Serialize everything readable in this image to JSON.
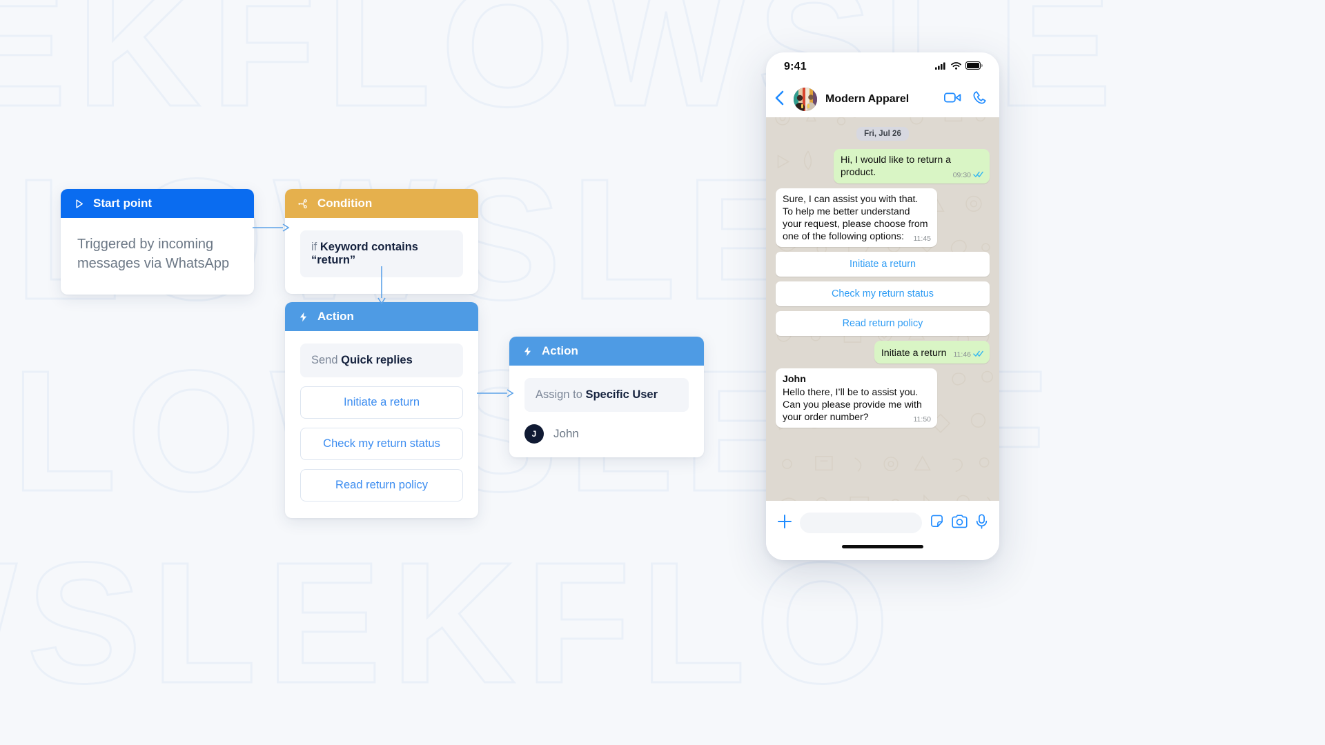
{
  "watermark": {
    "lines": [
      "EKFLOWSLE",
      "KFLOWSLEK",
      "FLOWSLEKF",
      "OWSLEKFLO"
    ]
  },
  "flow": {
    "nodes": [
      {
        "id": "start",
        "header": "Start point",
        "icon": "play-icon",
        "description": "Triggered by incoming messages via WhatsApp"
      },
      {
        "id": "condition",
        "header": "Condition",
        "icon": "branch-icon",
        "field_prefix": "if",
        "field_value": "Keyword contains “return”"
      },
      {
        "id": "action-quick-replies",
        "header": "Action",
        "icon": "bolt-icon",
        "field_prefix": "Send",
        "field_value": "Quick replies",
        "quick_replies": [
          "Initiate a return",
          "Check my return status",
          "Read return policy"
        ]
      },
      {
        "id": "action-assign",
        "header": "Action",
        "icon": "bolt-icon",
        "field_prefix": "Assign to",
        "field_value": "Specific User",
        "assignee": {
          "initial": "J",
          "name": "John"
        }
      }
    ],
    "colors": {
      "start_header": "#0a6cf0",
      "condition_header": "#e5b04d",
      "action_header": "#4e9be4",
      "connector": "#5ca2e8",
      "link_text": "#3b8cf0"
    }
  },
  "phone": {
    "status_bar": {
      "time": "9:41",
      "icons": [
        "cellular-signal-icon",
        "wifi-icon",
        "battery-icon"
      ]
    },
    "chat_header": {
      "back_icon": "back-chevron-icon",
      "avatar": "contact-avatar",
      "title": "Modern Apparel",
      "actions": [
        "video-call-icon",
        "voice-call-icon"
      ]
    },
    "conversation": {
      "date_label": "Fri, Jul 26",
      "messages": [
        {
          "direction": "out",
          "text": "Hi, I would like to return a product.",
          "time": "09:30",
          "status": "read"
        },
        {
          "direction": "in",
          "text": "Sure, I can assist you with that. To help me better understand your request, please choose from one of the following options:",
          "time": "11:45"
        },
        {
          "direction": "out",
          "text": "Initiate a return",
          "time": "11:46",
          "status": "read"
        },
        {
          "direction": "in",
          "sender": "John",
          "text": "Hello there, I’ll be to assist you. Can you please provide me with your order number?",
          "time": "11:50"
        }
      ],
      "quick_replies": [
        "Initiate a return",
        "Check my return status",
        "Read return policy"
      ]
    },
    "input_bar": {
      "attach_icon": "plus-icon",
      "field_value": "",
      "field_placeholder": "",
      "icons": [
        "sticker-icon",
        "camera-icon",
        "microphone-icon"
      ]
    },
    "colors": {
      "outgoing_bubble": "#d9f5c5",
      "incoming_bubble": "#ffffff",
      "chat_background": "#ded9d1",
      "ios_blue": "#2f9cf4",
      "read_tick": "#34b7f1"
    }
  }
}
